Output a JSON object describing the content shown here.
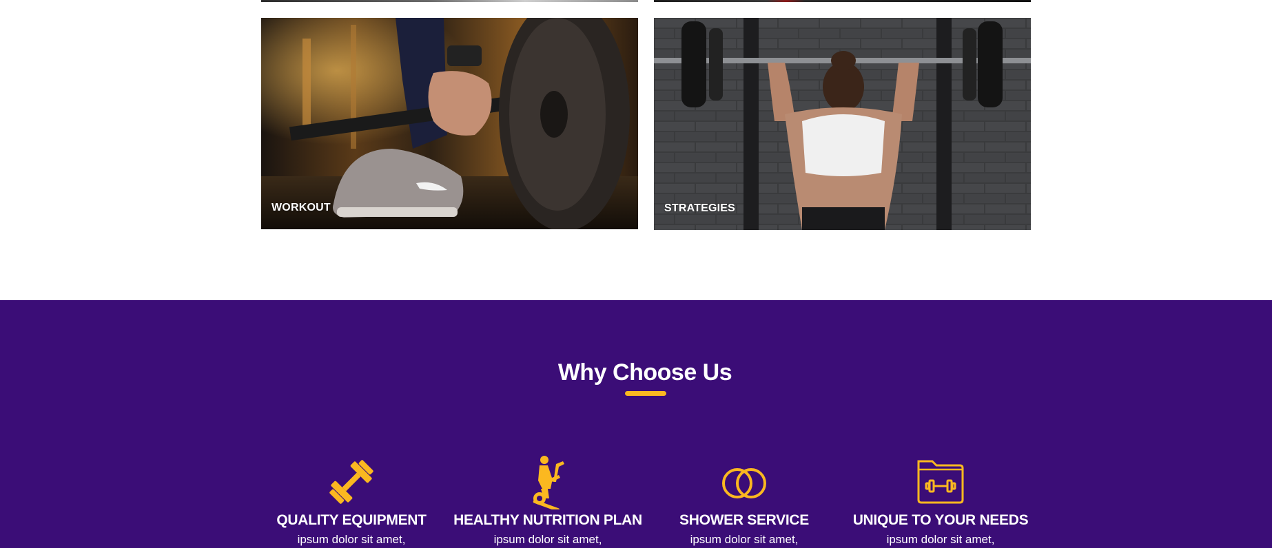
{
  "gallery": {
    "cards": [
      {
        "label": "WORKOUT",
        "image": "barbell-deadlift-photo"
      },
      {
        "label": "STRATEGIES",
        "image": "overhead-barbell-photo"
      }
    ]
  },
  "why_choose": {
    "title": "Why Choose Us",
    "accent_color": "#fbb820",
    "background_color": "#3b0d77",
    "features": [
      {
        "icon": "dumbbell-icon",
        "title": "QUALITY EQUIPMENT",
        "text": "ipsum dolor sit amet,"
      },
      {
        "icon": "exercise-bike-icon",
        "title": "HEALTHY NUTRITION PLAN",
        "text": "ipsum dolor sit amet,"
      },
      {
        "icon": "rings-icon",
        "title": "SHOWER SERVICE",
        "text": "ipsum dolor sit amet,"
      },
      {
        "icon": "dumbbell-folder-icon",
        "title": "UNIQUE TO YOUR NEEDS",
        "text": "ipsum dolor sit amet,"
      }
    ]
  }
}
